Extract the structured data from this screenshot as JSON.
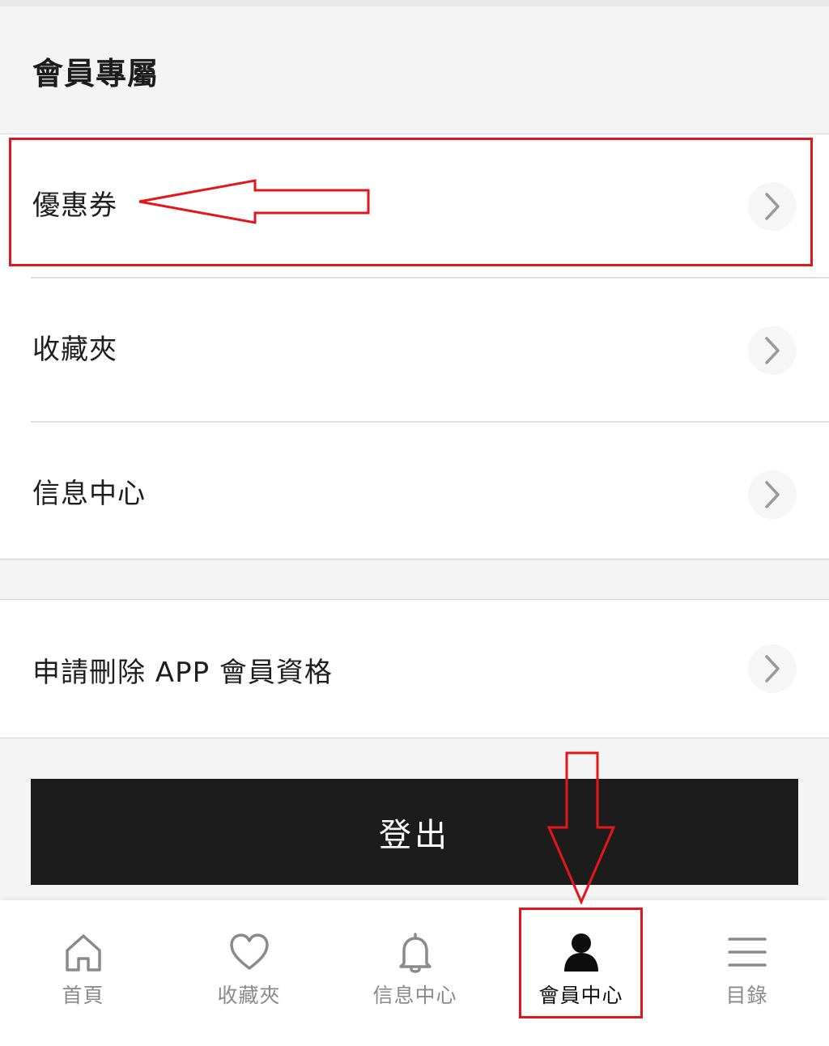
{
  "header": {
    "title": "會員專屬"
  },
  "menu": {
    "items": [
      {
        "label": "優惠券",
        "icon": "chevron-right-icon"
      },
      {
        "label": "收藏夾",
        "icon": "chevron-right-icon"
      },
      {
        "label": "信息中心",
        "icon": "chevron-right-icon"
      }
    ]
  },
  "account": {
    "delete_label": "申請刪除 APP 會員資格"
  },
  "logout": {
    "label": "登出"
  },
  "tabbar": {
    "items": [
      {
        "label": "首頁",
        "icon": "home-icon",
        "active": false
      },
      {
        "label": "收藏夾",
        "icon": "heart-icon",
        "active": false
      },
      {
        "label": "信息中心",
        "icon": "bell-icon",
        "active": false
      },
      {
        "label": "會員中心",
        "icon": "user-icon",
        "active": true
      },
      {
        "label": "目錄",
        "icon": "menu-icon",
        "active": false
      }
    ]
  },
  "colors": {
    "annotation": "#e3161b",
    "button_bg": "#1c1c1c",
    "tab_inactive": "#8a8a8a",
    "tab_active": "#111111"
  }
}
